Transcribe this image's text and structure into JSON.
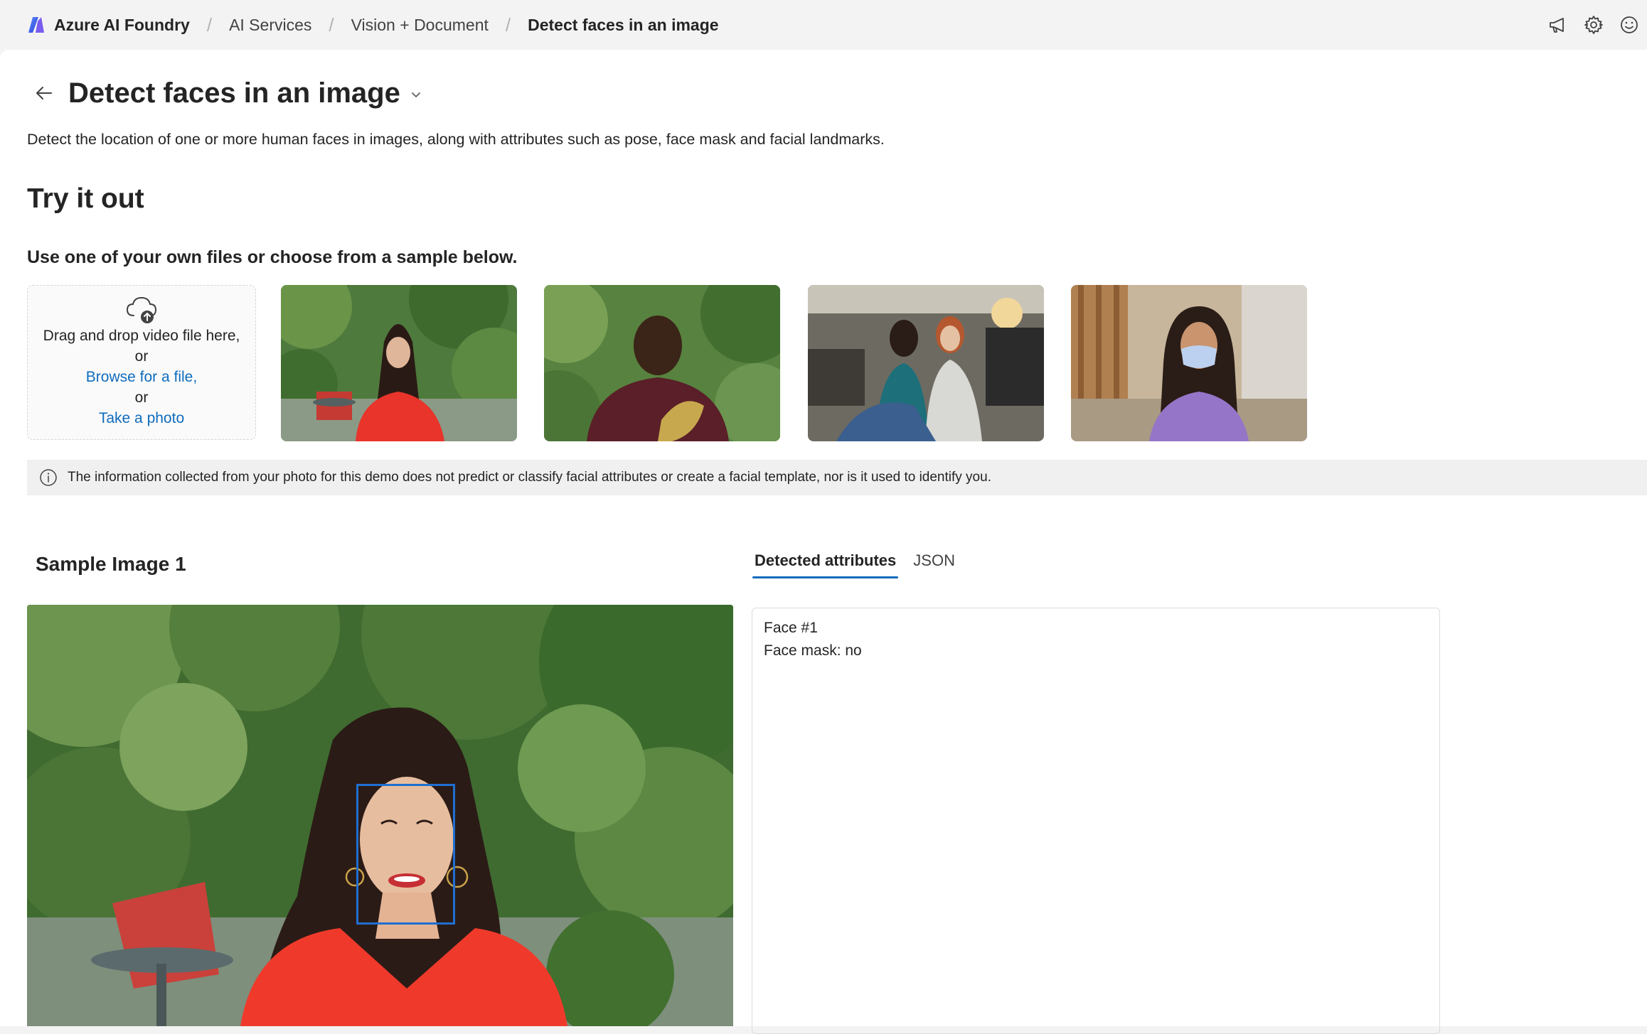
{
  "header": {
    "brand": "Azure AI Foundry",
    "breadcrumbs": [
      {
        "label": "AI Services"
      },
      {
        "label": "Vision + Document"
      },
      {
        "label": "Detect faces in an image"
      }
    ],
    "icons": [
      "megaphone-icon",
      "gear-icon",
      "smiley-icon"
    ]
  },
  "page": {
    "title": "Detect faces in an image",
    "description": "Detect the location of one or more human faces in images, along with attributes such as pose, face mask and facial landmarks.",
    "section_title": "Try it out",
    "subtitle": "Use one of your own files or choose from a sample below."
  },
  "upload": {
    "line1": "Drag and drop video file here,",
    "or1": "or",
    "browse": "Browse for a file,",
    "or2": "or",
    "photo": "Take a photo"
  },
  "samples": [
    {
      "name": "sample-thumbnail-1",
      "description": "Woman in red blouse, garden background"
    },
    {
      "name": "sample-thumbnail-2",
      "description": "Smiling man in maroon shirt holding fabric"
    },
    {
      "name": "sample-thumbnail-3",
      "description": "Two women looking at fabric in studio"
    },
    {
      "name": "sample-thumbnail-4",
      "description": "Woman wearing a face mask"
    }
  ],
  "info_banner": {
    "text": "The information collected from your photo for this demo does not predict or classify facial attributes or create a facial template, nor is it used to identify you."
  },
  "result": {
    "sample_title": "Sample Image 1",
    "tabs": [
      {
        "label": "Detected attributes",
        "active": true
      },
      {
        "label": "JSON",
        "active": false
      }
    ],
    "attributes": [
      "Face #1",
      "Face mask: no"
    ]
  },
  "colors": {
    "accent": "#0f6cbd",
    "face_box": "#1f6fd1",
    "topbar_bg": "#f3f3f3",
    "panel_bg": "#ffffff"
  }
}
